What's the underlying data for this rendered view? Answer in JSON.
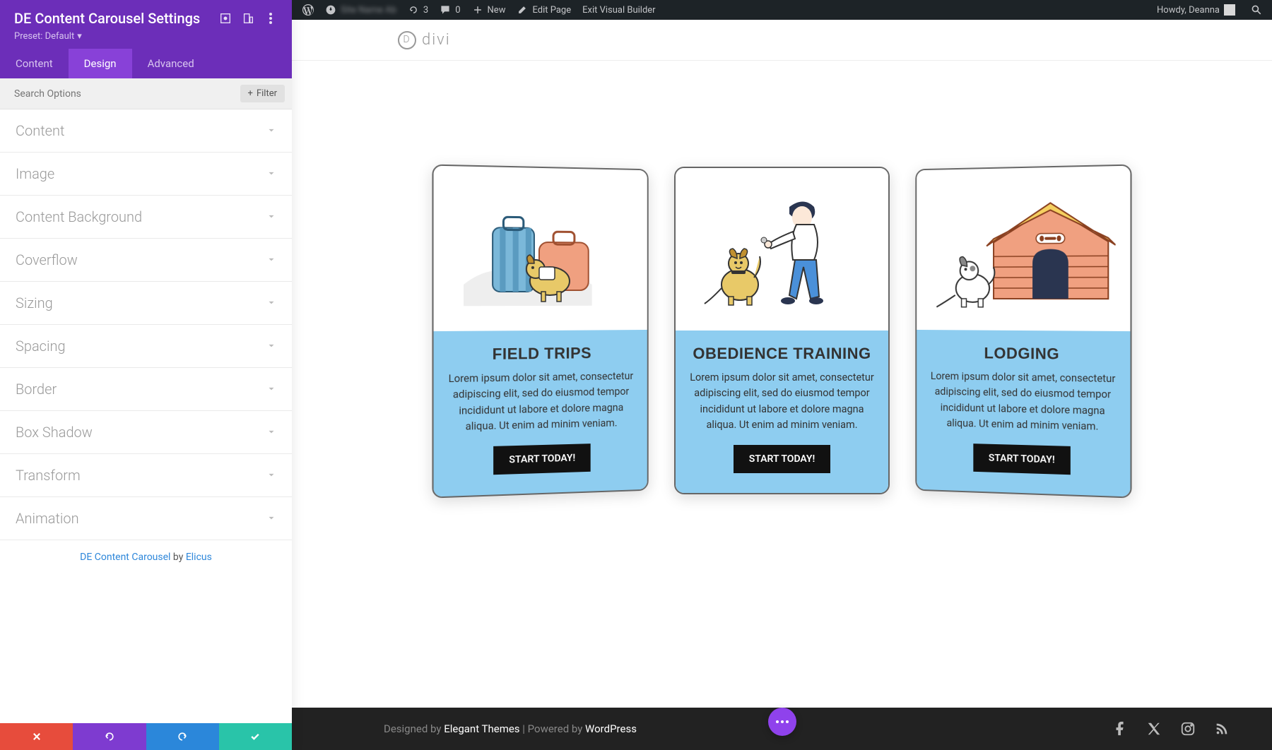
{
  "wp_bar": {
    "updates_count": "3",
    "comments_count": "0",
    "new_label": "New",
    "edit_page": "Edit Page",
    "exit_builder": "Exit Visual Builder",
    "howdy": "Howdy, Deanna"
  },
  "panel": {
    "title": "DE Content Carousel Settings",
    "preset_label": "Preset: Default",
    "tabs": {
      "content": "Content",
      "design": "Design",
      "advanced": "Advanced"
    },
    "search_placeholder": "Search Options",
    "filter_label": "Filter",
    "sections": [
      "Content",
      "Image",
      "Content Background",
      "Coverflow",
      "Sizing",
      "Spacing",
      "Border",
      "Box Shadow",
      "Transform",
      "Animation"
    ],
    "credit_module": "DE Content Carousel",
    "credit_by": " by ",
    "credit_author": "Elicus"
  },
  "preview": {
    "logo_text": "divi",
    "cards": [
      {
        "title": "FIELD TRIPS",
        "desc": "Lorem ipsum dolor sit amet, consectetur adipiscing elit, sed do eiusmod tempor incididunt ut labore et dolore magna aliqua. Ut enim ad minim veniam.",
        "cta": "START TODAY!"
      },
      {
        "title": "OBEDIENCE TRAINING",
        "desc": "Lorem ipsum dolor sit amet, consectetur adipiscing elit, sed do eiusmod tempor incididunt ut labore et dolore magna aliqua. Ut enim ad minim veniam.",
        "cta": "START TODAY!"
      },
      {
        "title": "LODGING",
        "desc": "Lorem ipsum dolor sit amet, consectetur adipiscing elit, sed do eiusmod tempor incididunt ut labore et dolore magna aliqua. Ut enim ad minim veniam.",
        "cta": "START TODAY!"
      }
    ],
    "footer": {
      "designed_by": "Designed by ",
      "theme": "Elegant Themes",
      "sep": " | Powered by ",
      "platform": "WordPress"
    }
  }
}
